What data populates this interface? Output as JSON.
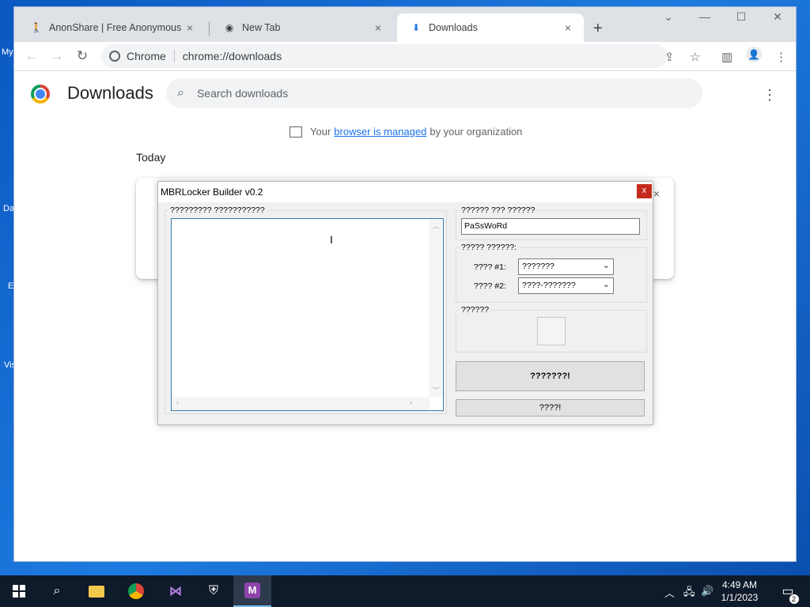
{
  "desktop": {
    "fragments": [
      "My",
      "Da",
      "E",
      "Vis"
    ]
  },
  "browser": {
    "tabs": [
      {
        "title": "AnonShare | Free Anonymous Fi",
        "close": "×"
      },
      {
        "title": "New Tab",
        "close": "×"
      },
      {
        "title": "Downloads",
        "close": "×"
      }
    ],
    "new_tab": "+",
    "window_controls": {
      "tab_search": "⌄",
      "minimize": "—",
      "maximize": "☐",
      "close": "✕"
    },
    "omnibox": {
      "site_label": "Chrome",
      "url": "chrome://downloads"
    }
  },
  "downloads_page": {
    "title": "Downloads",
    "search_placeholder": "Search downloads",
    "managed": {
      "prefix": "Your",
      "link": "browser is managed",
      "suffix": "by your organization"
    },
    "section": "Today",
    "card_close": "×"
  },
  "builder": {
    "title": "MBRLocker Builder v0.2",
    "close": "x",
    "message_group_label": "????????? ???????????",
    "message_text": "",
    "password_group_label": "?????? ??? ??????",
    "password_value": "PaSsWoRd",
    "options_group_label": "????? ??????:",
    "option1_label": "???? #1:",
    "option1_value": "???????",
    "option2_label": "???? #2:",
    "option2_value": "????-???????",
    "icon_group_label": "??????",
    "build_button": "???????!",
    "secondary_button": "????!"
  },
  "taskbar": {
    "time": "4:49 AM",
    "date": "1/1/2023",
    "notification_count": "2"
  },
  "colors": {
    "desktop": "#1a6fd0",
    "taskbar": "#0f1a2a",
    "close_red": "#c42b1c",
    "link": "#1a73e8"
  }
}
